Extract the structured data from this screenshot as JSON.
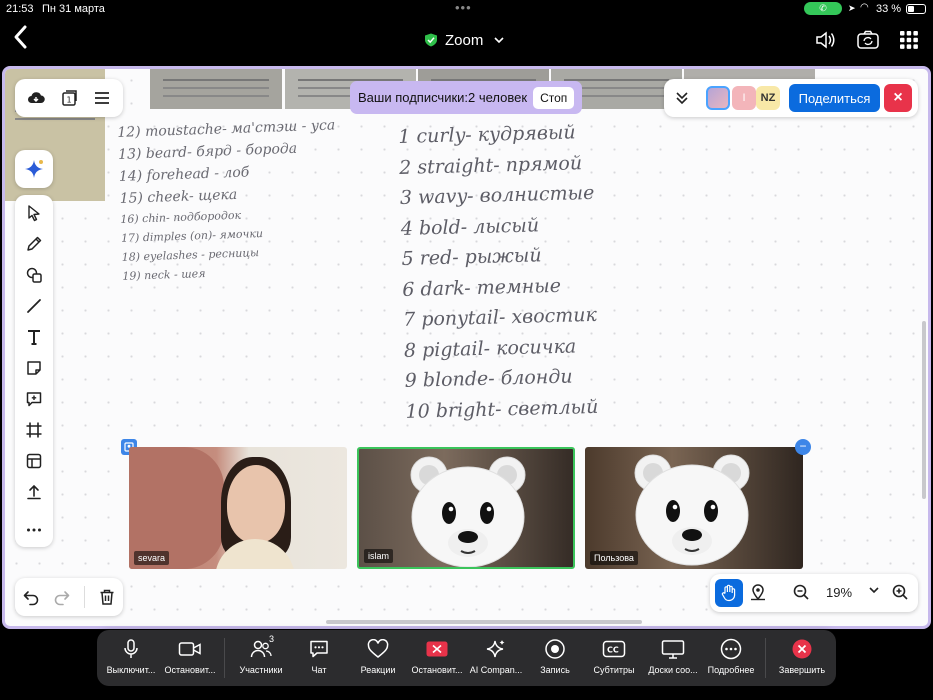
{
  "status_bar": {
    "time": "21:53",
    "date": "Пн 31 марта",
    "battery": "33 %"
  },
  "header": {
    "title": "Zoom"
  },
  "subscribers": {
    "text": "Ваши подписчики:2 человек",
    "stop_label": "Стоп"
  },
  "share_panel": {
    "avatar_initial_2": "I",
    "avatar_initial_3": "NZ",
    "share_label": "Поделиться",
    "close_label": "×"
  },
  "notes_left": [
    "12) moustache- мa'стэш - уса",
    "13) beard- бярд - борода",
    "14) forehead - лоб",
    "15) cheek- щека",
    "16) chin- подбородок",
    "17) dimples (on)- ямочки",
    "18) eyelashes - ресницы",
    "19) neck - шея"
  ],
  "notes_right": [
    "1 curly- кудрявый",
    "2 straight- прямой",
    "3 wavy- волнистые",
    "4 bold- лысый",
    "5 red- рыжый",
    "6 dark- темные",
    "7 ponytail- хвостик",
    "8 pigtail- косичка",
    "9 blonde- блонди",
    "10 bright- светлый"
  ],
  "tiles": [
    {
      "name": "sevara"
    },
    {
      "name": "islam"
    },
    {
      "name": "Пользова"
    }
  ],
  "zoom": {
    "value": "19%"
  },
  "dock": {
    "items": [
      {
        "label": "Выключит...",
        "icon": "microphone-icon"
      },
      {
        "label": "Остановит...",
        "icon": "video-camera-icon"
      },
      {
        "label": "Участники",
        "icon": "participants-icon",
        "badge": "3"
      },
      {
        "label": "Чат",
        "icon": "chat-icon"
      },
      {
        "label": "Реакции",
        "icon": "heart-icon"
      },
      {
        "label": "Остановит...",
        "icon": "share-screen-icon"
      },
      {
        "label": "AI Compan...",
        "icon": "ai-sparkle-icon"
      },
      {
        "label": "Запись",
        "icon": "record-icon"
      },
      {
        "label": "Субтитры",
        "icon": "captions-icon"
      },
      {
        "label": "Доски соо...",
        "icon": "whiteboard-icon"
      },
      {
        "label": "Подробнее",
        "icon": "more-icon"
      },
      {
        "label": "Завершить",
        "icon": "end-call-icon"
      }
    ]
  },
  "colors": {
    "accent_blue": "#0b6bde",
    "board_border": "#c7b9ec",
    "end_red": "#e8334a",
    "active_green": "#3bc45b"
  }
}
